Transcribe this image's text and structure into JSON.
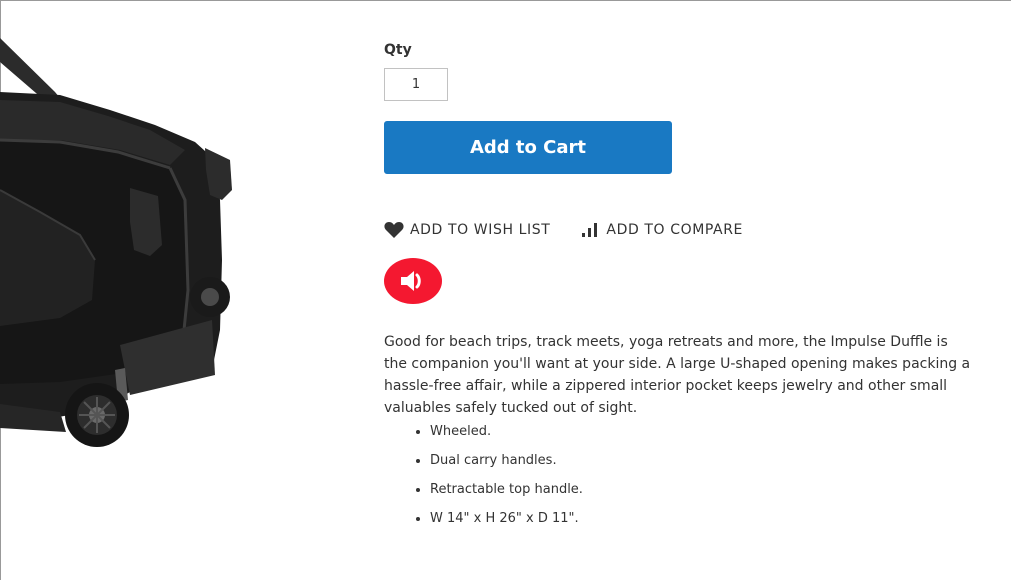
{
  "qty": {
    "label": "Qty",
    "value": "1"
  },
  "add_to_cart": {
    "label": "Add to Cart",
    "color": "#1979c3"
  },
  "actions": {
    "wishlist_label": "ADD TO WISH LIST",
    "wishlist_icon": "heart-icon",
    "compare_label": "ADD TO COMPARE",
    "compare_icon": "bar-chart-icon"
  },
  "audio": {
    "icon": "speaker-icon",
    "color": "#f41830"
  },
  "description": {
    "text": "Good for beach trips, track meets, yoga retreats and more, the Impulse Duffle is the companion you'll want at your side. A large U-shaped opening makes packing a hassle-free affair, while a zippered interior pocket keeps jewelry and other small valuables safely tucked out of sight.",
    "features": [
      "Wheeled.",
      "Dual carry handles.",
      "Retractable top handle.",
      "W 14\" x H 26\" x D 11\"."
    ]
  },
  "product_image": {
    "subject": "black wheeled duffle bag"
  }
}
